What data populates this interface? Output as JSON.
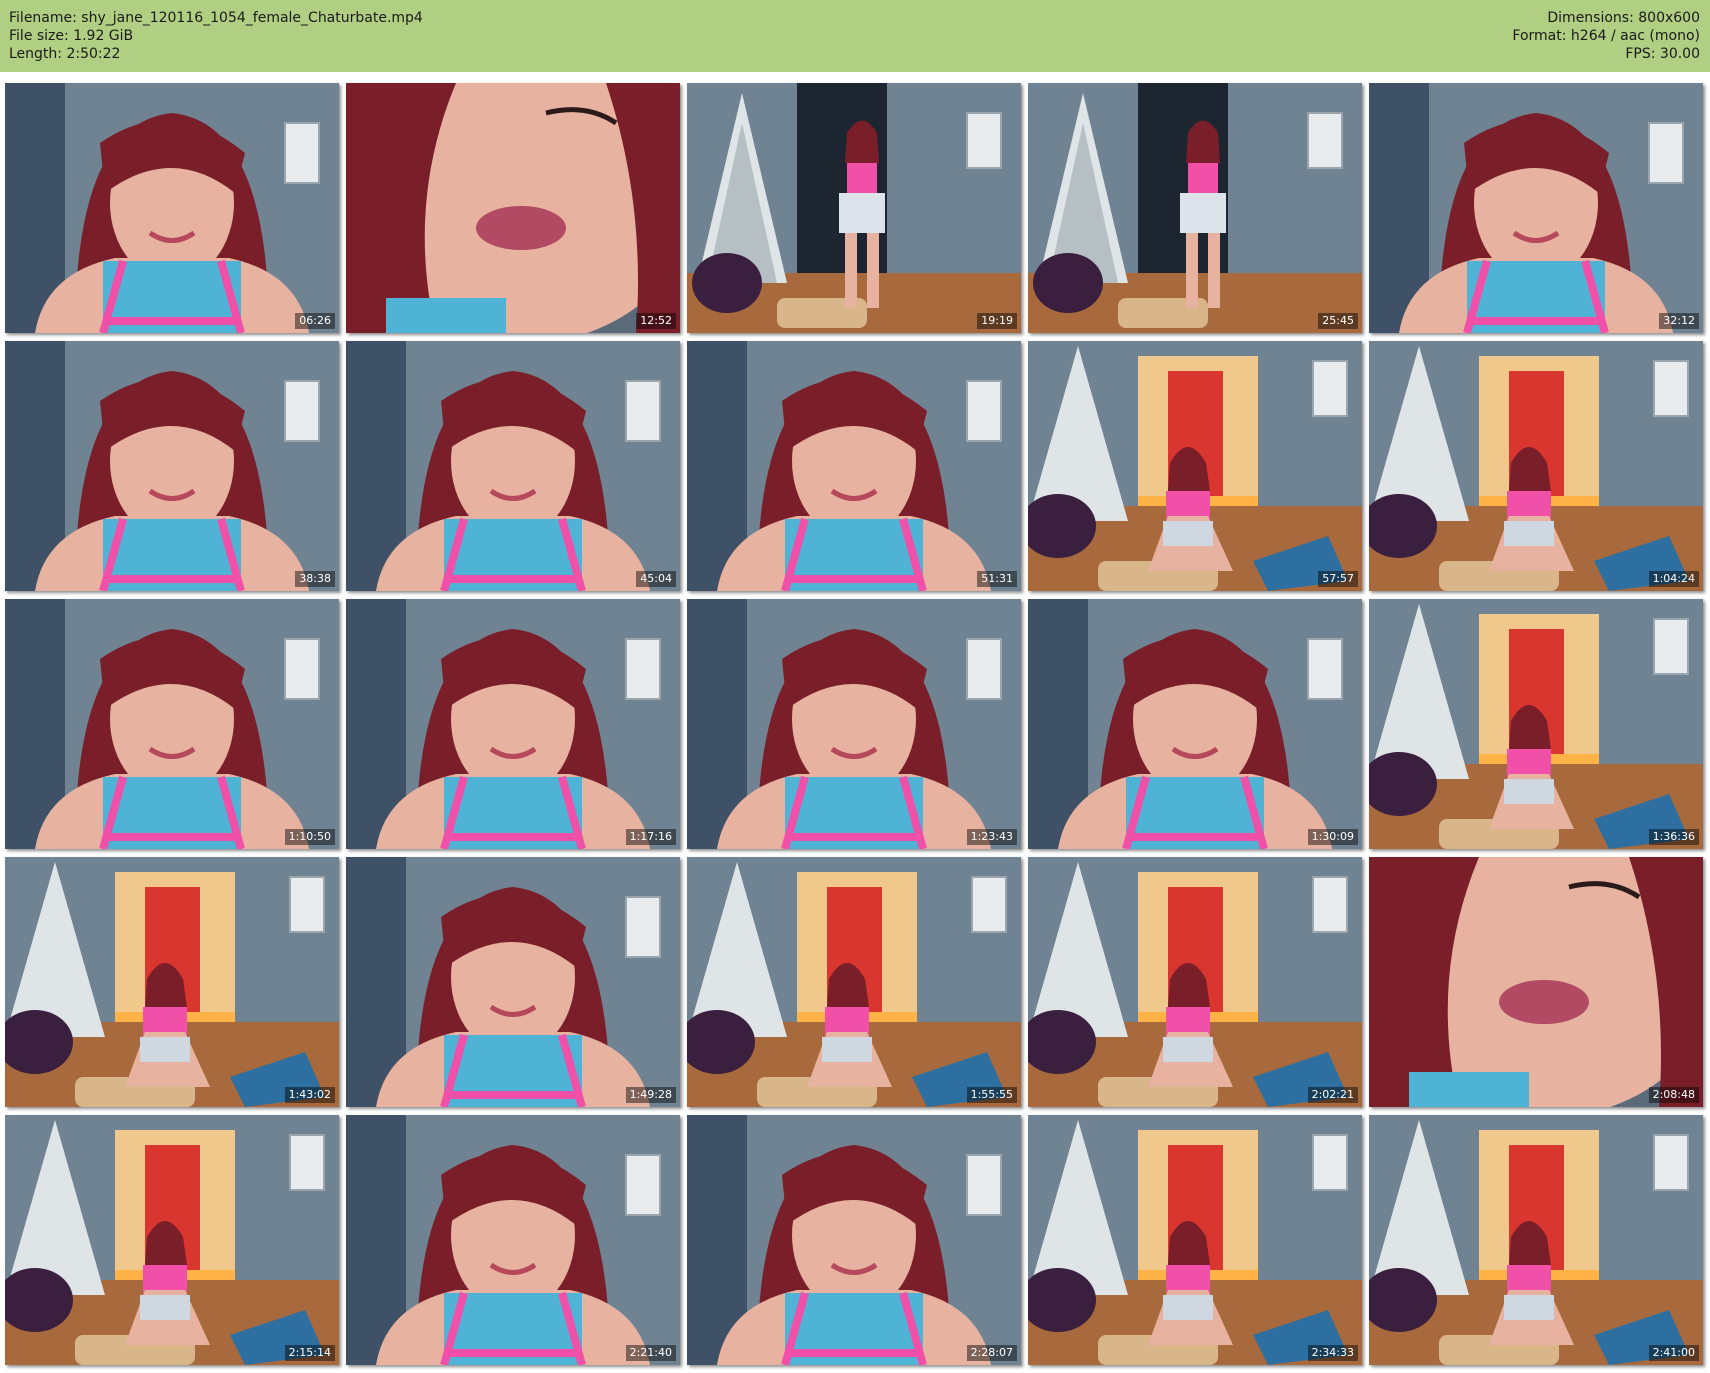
{
  "header": {
    "filename": "Filename: shy_jane_120116_1054_female_Chaturbate.mp4",
    "filesize": "File size: 1.92 GiB",
    "length": "Length: 2:50:22",
    "dimensions": "Dimensions: 800x600",
    "format": "Format: h264 / aac (mono)",
    "fps": "FPS: 30.00"
  },
  "thumbnails": [
    {
      "time": "06:26",
      "scene": "closeup"
    },
    {
      "time": "12:52",
      "scene": "extreme-closeup"
    },
    {
      "time": "19:19",
      "scene": "wide-tree"
    },
    {
      "time": "25:45",
      "scene": "wide-tree"
    },
    {
      "time": "32:12",
      "scene": "closeup"
    },
    {
      "time": "38:38",
      "scene": "closeup"
    },
    {
      "time": "45:04",
      "scene": "closeup"
    },
    {
      "time": "51:31",
      "scene": "closeup"
    },
    {
      "time": "57:57",
      "scene": "wide-room"
    },
    {
      "time": "1:04:24",
      "scene": "wide-room"
    },
    {
      "time": "1:10:50",
      "scene": "closeup"
    },
    {
      "time": "1:17:16",
      "scene": "closeup"
    },
    {
      "time": "1:23:43",
      "scene": "closeup"
    },
    {
      "time": "1:30:09",
      "scene": "closeup"
    },
    {
      "time": "1:36:36",
      "scene": "wide-room"
    },
    {
      "time": "1:43:02",
      "scene": "wide-room"
    },
    {
      "time": "1:49:28",
      "scene": "closeup"
    },
    {
      "time": "1:55:55",
      "scene": "wide-room"
    },
    {
      "time": "2:02:21",
      "scene": "wide-room"
    },
    {
      "time": "2:08:48",
      "scene": "extreme-closeup"
    },
    {
      "time": "2:15:14",
      "scene": "wide-room"
    },
    {
      "time": "2:21:40",
      "scene": "closeup"
    },
    {
      "time": "2:28:07",
      "scene": "closeup"
    },
    {
      "time": "2:34:33",
      "scene": "wide-room"
    },
    {
      "time": "2:41:00",
      "scene": "wide-room"
    }
  ],
  "colors": {
    "header_bg": "#b1cf83",
    "wall": "#6f8393",
    "floor": "#a8693d",
    "hair": "#7a1f2a",
    "top_blue": "#4fb3d6",
    "top_pink": "#f050a8",
    "skin": "#e7b29f",
    "tree": "#dfe4e6",
    "door_red": "#d8362f"
  }
}
